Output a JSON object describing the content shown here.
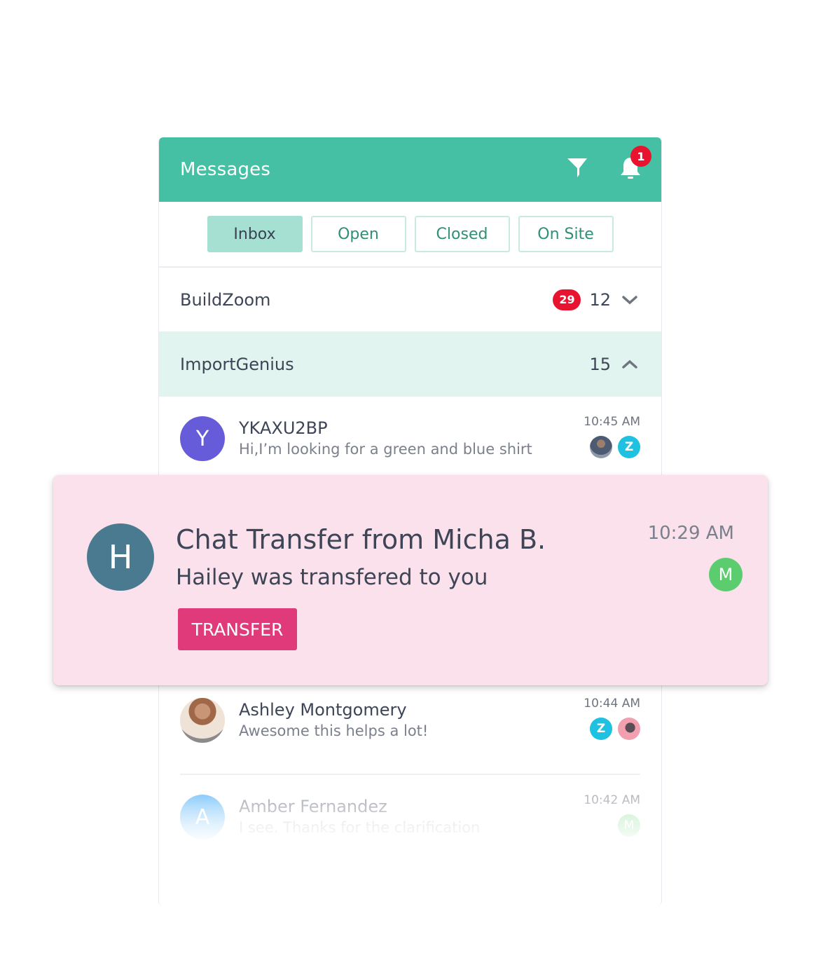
{
  "header": {
    "title": "Messages",
    "filter_icon": "filter-icon",
    "bell_icon": "bell-icon",
    "notification_count": "1"
  },
  "tabs": [
    {
      "label": "Inbox",
      "active": true
    },
    {
      "label": "Open",
      "active": false
    },
    {
      "label": "Closed",
      "active": false
    },
    {
      "label": "On Site",
      "active": false
    }
  ],
  "groups": [
    {
      "name": "BuildZoom",
      "unread_badge": "29",
      "count": "12",
      "expanded": false,
      "chevron_icon": "chevron-down-icon"
    },
    {
      "name": "ImportGenius",
      "unread_badge": null,
      "count": "15",
      "expanded": true,
      "chevron_icon": "chevron-up-icon"
    }
  ],
  "conversations": [
    {
      "avatar_letter": "Y",
      "avatar_color": "#665bd8",
      "name": "YKAXU2BP",
      "message": "Hi,I’m looking for a green and blue shirt",
      "time": "10:45 AM",
      "agents": [
        {
          "type": "photo",
          "label": ""
        },
        {
          "type": "letter",
          "label": "Z",
          "color": "#1ec1e0"
        }
      ]
    },
    {
      "avatar_letter": "",
      "avatar_color": "#d9b8a5",
      "name": "Ashley Montgomery",
      "message": "Awesome this helps a lot!",
      "time": "10:44 AM",
      "agents": [
        {
          "type": "letter",
          "label": "Z",
          "color": "#1ec1e0"
        },
        {
          "type": "photo",
          "label": ""
        }
      ]
    },
    {
      "avatar_letter": "A",
      "avatar_color": "#9fd4fb",
      "name": "Amber Fernandez",
      "message": "I see. Thanks for the clarification",
      "time": "10:42 AM",
      "agents": [
        {
          "type": "letter",
          "label": "M",
          "color": "#c7efcd"
        }
      ]
    }
  ],
  "toast": {
    "avatar_letter": "H",
    "title": "Chat Transfer from Micha B.",
    "subtitle": "Hailey was transfered to you",
    "button_label": "TRANSFER",
    "time": "10:29 AM",
    "agent_letter": "M"
  },
  "colors": {
    "brand": "#45c0a4",
    "badge_red": "#e8132f",
    "transfer_pink": "#e03a7a",
    "toast_bg": "#fae1ec"
  }
}
